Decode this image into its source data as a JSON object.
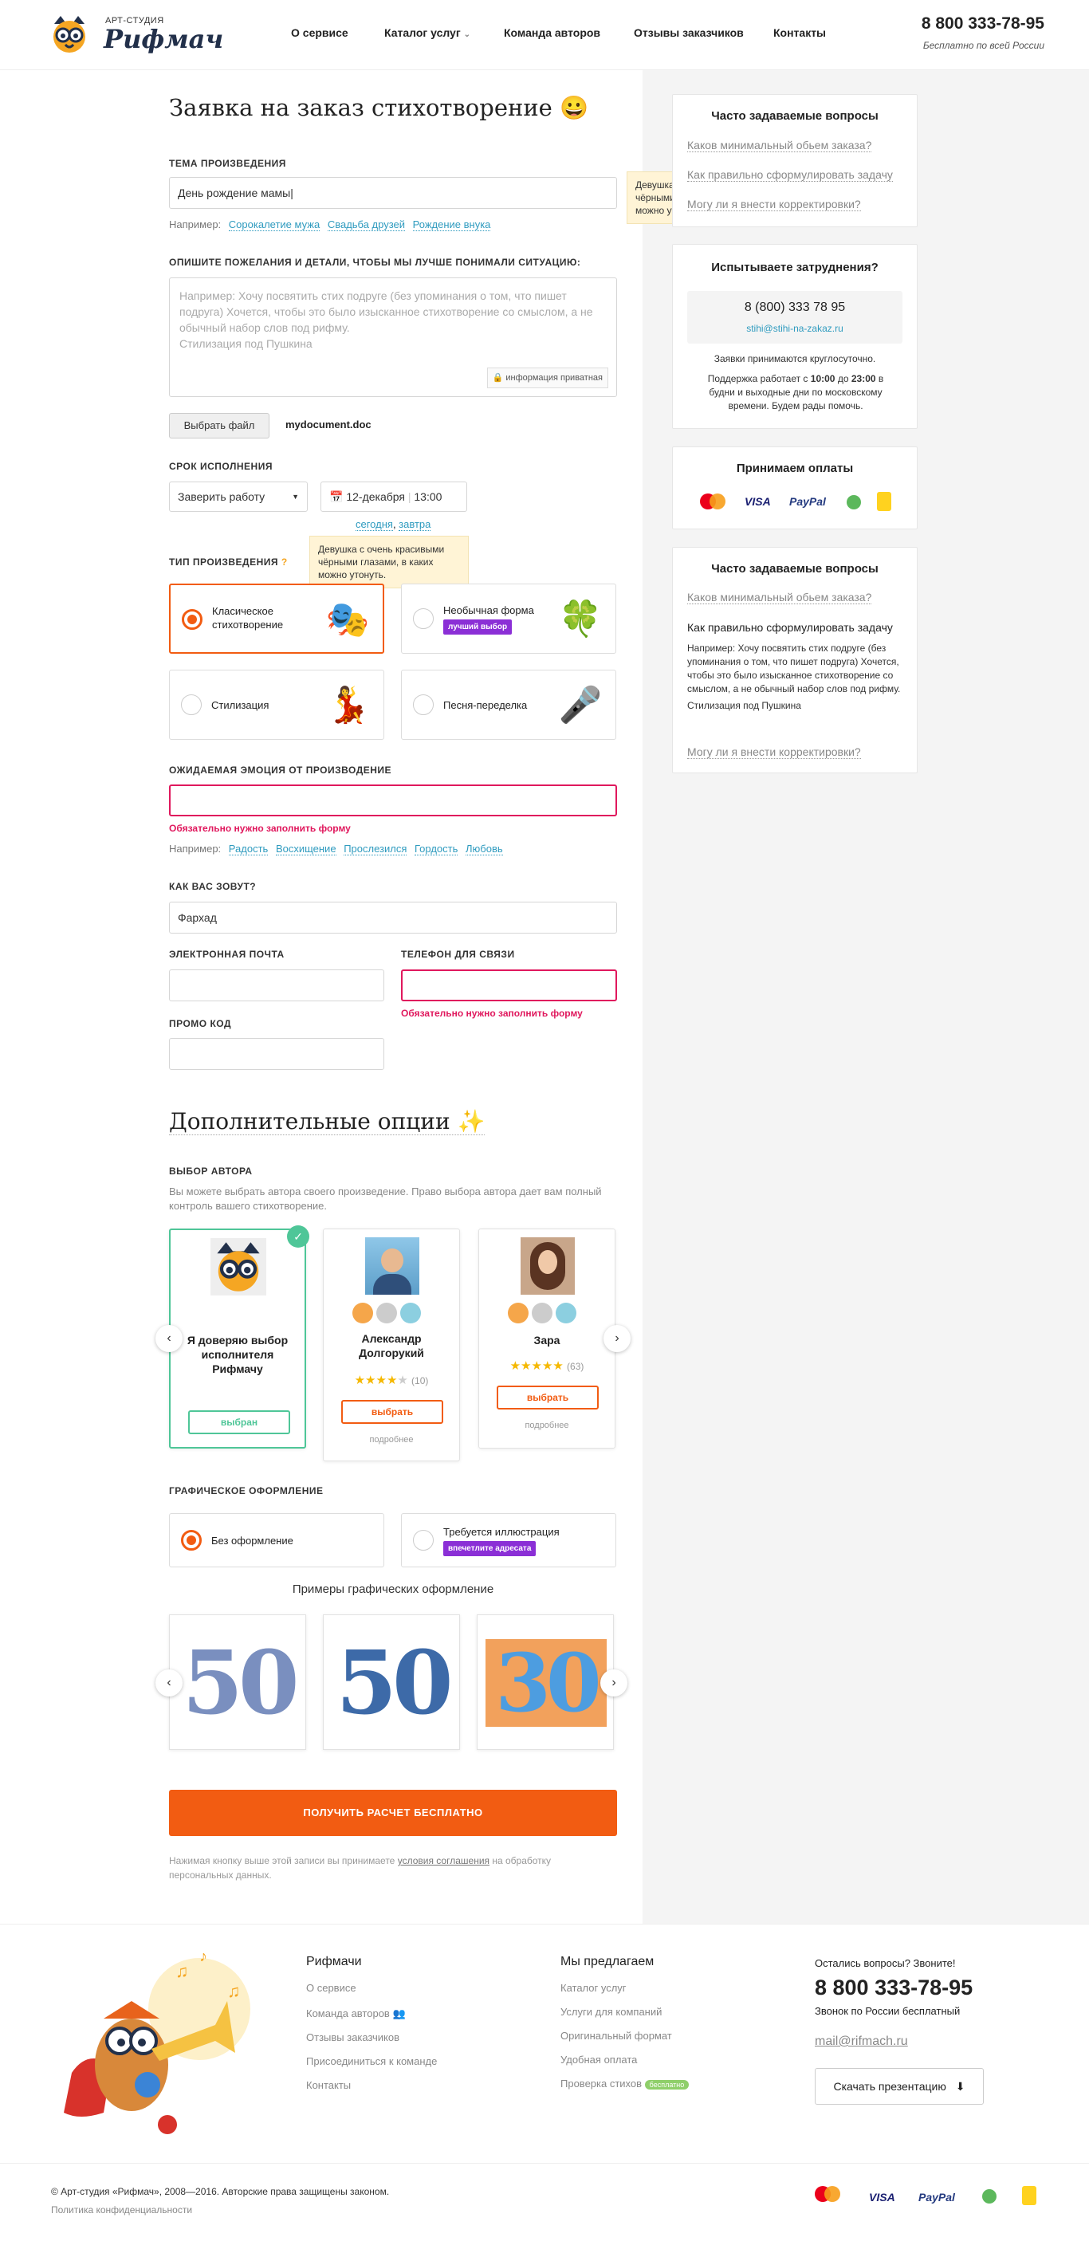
{
  "header": {
    "logo_small": "АРТ-СТУДИЯ",
    "logo_big": "Рифмач",
    "nav": [
      "О сервисе",
      "Каталог услуг",
      "Команда авторов",
      "Отзывы заказчиков",
      "Контакты"
    ],
    "nav_caret": "⌄",
    "phone": "8 800 333-78-95",
    "phone_sub": "Бесплатно по всей России"
  },
  "form": {
    "title": "Заявка на заказ стихотворение",
    "title_emoji": "😀",
    "topic_label": "ТЕМА ПРОИЗВЕДЕНИЯ",
    "topic_value": "День рождение мамы|",
    "topic_hint_prefix": "Например:",
    "topic_hints": [
      "Сорокалетие мужа",
      "Свадьба друзей",
      "Рождение внука"
    ],
    "tooltip": "Девушка с очень красивыми чёрными глазами, в каких можно утонуть.",
    "details_label": "ОПИШИТЕ ПОЖЕЛАНИЯ И ДЕТАЛИ, ЧТОБЫ МЫ ЛУЧШЕ ПОНИМАЛИ СИТУАЦИЮ:",
    "details_placeholder": "Например: Хочу посвятить стих подруге (без упоминания о том, что пишет подруга) Хочется, чтобы это было изысканное стихотворение со смыслом, а не обычный набор слов под рифму.",
    "details_placeholder_2": "Стилизация под Пушкина",
    "private_label": "информация приватная",
    "file_button": "Выбрать файл",
    "file_name": "mydocument.doc",
    "deadline_label": "СРОК ИСПОЛНЕНИЯ",
    "deadline_select": "Заверить работу",
    "deadline_date": "12-декабря",
    "deadline_time": "13:00",
    "deadline_links": [
      "сегодня",
      "завтра"
    ],
    "type_label": "ТИП ПРОИЗВЕДЕНИЯ",
    "type_help": "?",
    "types": [
      {
        "label": "Класическое стихотворение",
        "badge": "",
        "icon": "🎭",
        "selected": true
      },
      {
        "label": "Необычная форма",
        "badge": "лучший выбор",
        "icon": "🍀",
        "selected": false
      },
      {
        "label": "Стилизация",
        "badge": "",
        "icon": "💃",
        "selected": false
      },
      {
        "label": "Песня-переделка",
        "badge": "",
        "icon": "🎤",
        "selected": false
      }
    ],
    "emotion_label": "ОЖИДАЕМАЯ ЭМОЦИЯ ОТ ПРОИЗВОДЕНИЕ",
    "emotion_value": "",
    "required_error": "Обязательно нужно заполнить форму",
    "emotion_hint_prefix": "Например:",
    "emotion_hints": [
      "Радость",
      "Восхищение",
      "Прослезился",
      "Гордость",
      "Любовь"
    ],
    "name_label": "КАК ВАС ЗОВУТ?",
    "name_value": "Фархад",
    "email_label": "ЭЛЕКТРОННАЯ ПОЧТА",
    "email_value": "",
    "phone_label": "ТЕЛЕФОН ДЛЯ СВЯЗИ",
    "phone_value": "",
    "promo_label": "ПРОМО КОД",
    "promo_value": ""
  },
  "extra": {
    "title": "Дополнительные опции",
    "title_emoji": "✨",
    "author_label": "ВЫБОР АВТОРА",
    "author_desc": "Вы можете выбрать автора своего произведение. Право выбора автора дает вам полный контроль вашего стихотворение.",
    "authors": [
      {
        "name": "Я доверяю выбор исполнителя Рифмачу",
        "rating": null,
        "reviews": "",
        "button": "выбран",
        "more": "",
        "selected": true
      },
      {
        "name": "Александр Долгорукий",
        "rating": 4,
        "reviews": "(10)",
        "button": "выбрать",
        "more": "подробнее",
        "selected": false
      },
      {
        "name": "Зара",
        "rating": 5,
        "reviews": "(63)",
        "button": "выбрать",
        "more": "подробнее",
        "selected": false
      }
    ],
    "design_label": "ГРАФИЧЕСКОЕ ОФОРМЛЕНИЕ",
    "design_options": [
      {
        "label": "Без оформление",
        "badge": "",
        "selected": true
      },
      {
        "label": "Требуется иллюстрация",
        "badge": "впечетлите адресата",
        "selected": false
      }
    ],
    "examples_title": "Примеры графических оформление",
    "examples": [
      "50",
      "50",
      "30"
    ],
    "cta": "ПОЛУЧИТЬ РАСЧЕТ БЕСПЛАТНО",
    "agree_prefix": "Нажимая кнопку выше этой записи вы принимаете",
    "agree_link": "условия соглашения",
    "agree_suffix": "на обработку персональных данных."
  },
  "sidebar": {
    "faq1_title": "Часто задаваемые вопросы",
    "faq1_links": [
      "Каков минимальный обьем заказа?",
      "Как правильно сформулировать задачу",
      "Могу ли я внести корректировки?"
    ],
    "help_title": "Испытываете затруднения?",
    "help_phone": "8 (800) 333 78 95",
    "help_email": "stihi@stihi-na-zakaz.ru",
    "help_note1": "Заявки принимаются круглосуточно.",
    "help_note2_a": "Поддержка работает с",
    "help_note2_from": "10:00",
    "help_note2_b": "до",
    "help_note2_to": "23:00",
    "help_note2_c": "в будни и выходные дни по московскому времени. Будем рады помочь.",
    "pay_title": "Принимаем оплаты",
    "pay_logos": [
      "mastercard",
      "VISA",
      "PayPal"
    ],
    "faq2_title": "Часто задаваемые вопросы",
    "faq2_q1": "Каков минимальный обьем заказа?",
    "faq2_q2": "Как правильно сформулировать задачу",
    "faq2_answer": "Например: Хочу посвятить стих подруге (без упоминания о том, что пишет подруга) Хочется, чтобы это было изысканное стихотворение со смыслом, а не обычный набор слов под рифму.",
    "faq2_answer2": "Стилизация под Пушкина",
    "faq2_q3": "Могу ли я внести корректировки?"
  },
  "footer": {
    "col1_title": "Рифмачи",
    "col1_links": [
      "О сервисе",
      "Команда авторов",
      "Отзывы заказчиков",
      "Присоединиться к команде",
      "Контакты"
    ],
    "col2_title": "Мы предлагаем",
    "col2_links": [
      "Каталог услуг",
      "Услуги для компаний",
      "Оригинальный формат",
      "Удобная оплата",
      "Проверка стихов"
    ],
    "col2_badge": "бесплатно",
    "contact_q": "Остались вопросы? Звоните!",
    "phone": "8 800 333-78-95",
    "phone_sub": "Звонок по России бесплатный",
    "email": "mail@rifmach.ru",
    "pres_button": "Скачать презентацию",
    "copyright": "© Арт-студия «Рифмач», 2008—2016. Авторские права защищены законом.",
    "privacy": "Политика конфиденциальности",
    "pay_logos": [
      "mastercard",
      "VISA",
      "PayPal"
    ]
  },
  "colors": {
    "accent": "#f25c12",
    "error": "#e0185d",
    "link": "#2f9bbf",
    "success": "#4fc698",
    "badge": "#8b2fd6"
  }
}
